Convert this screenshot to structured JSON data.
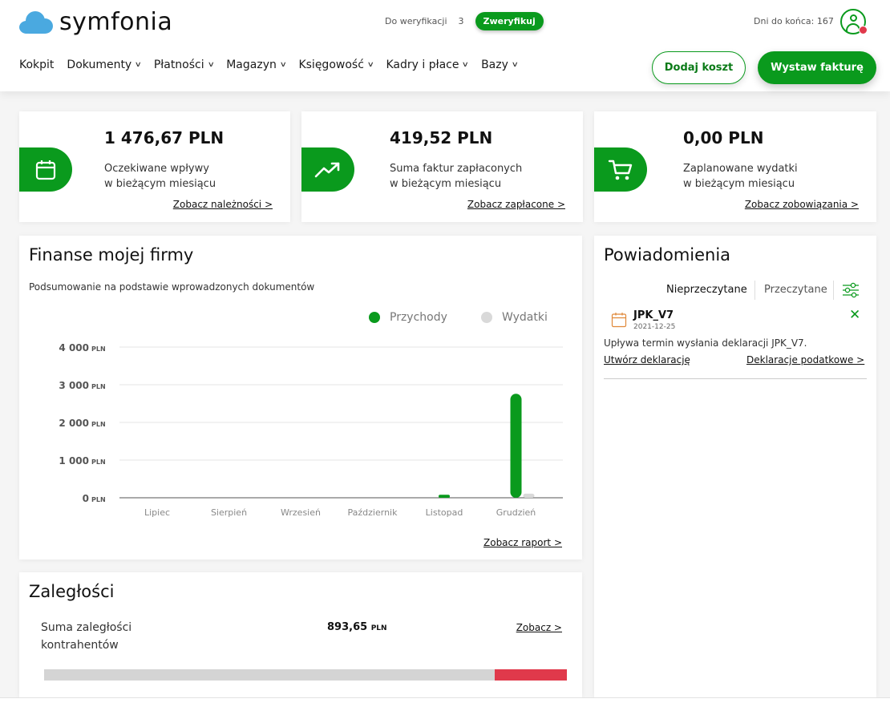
{
  "brand": {
    "name": "symfonia",
    "cloud_color": "#4aa9e0"
  },
  "header": {
    "verification_label": "Do weryfikacji",
    "verification_count": "3",
    "verify_button": "Zweryfikuj",
    "days_left": "Dni do końca: 167",
    "avatar_icon": "user-icon",
    "nav": [
      "Kokpit",
      "Dokumenty",
      "Płatności",
      "Magazyn",
      "Księgowość",
      "Kadry i płace",
      "Bazy"
    ],
    "add_cost_button": "Dodaj koszt",
    "issue_invoice_button": "Wystaw fakturę"
  },
  "colors": {
    "accent": "#0a9a1d",
    "alert": "#e0394b",
    "expense": "#d9d9d9"
  },
  "stats": [
    {
      "amount": "1 476,67 PLN",
      "line1": "Oczekiwane wpływy",
      "line2": "w bieżącym miesiącu",
      "link": "Zobacz należności >",
      "icon": "calendar-icon"
    },
    {
      "amount": "419,52 PLN",
      "line1": "Suma faktur zapłaconych",
      "line2": "w bieżącym miesiącu",
      "link": "Zobacz zapłacone >",
      "icon": "trend-up-icon"
    },
    {
      "amount": "0,00 PLN",
      "line1": "Zaplanowane wydatki",
      "line2": "w bieżącym miesiącu",
      "link": "Zobacz zobowiązania >",
      "icon": "cart-icon"
    }
  ],
  "finance": {
    "title": "Finanse mojej firmy",
    "subtitle": "Podsumowanie na podstawie wprowadzonych dokumentów",
    "report_link": "Zobacz raport >"
  },
  "chart_data": {
    "type": "bar",
    "categories": [
      "Lipiec",
      "Sierpień",
      "Wrzesień",
      "Październik",
      "Listopad",
      "Grudzień"
    ],
    "series": [
      {
        "name": "Przychody",
        "values": [
          0,
          0,
          0,
          0,
          80,
          2760
        ]
      },
      {
        "name": "Wydatki",
        "values": [
          0,
          0,
          0,
          0,
          0,
          110
        ]
      }
    ],
    "yticks": [
      "4 000",
      "3 000",
      "2 000",
      "1 000",
      "0"
    ],
    "yunit": "PLN",
    "ylim": [
      0,
      4000
    ],
    "grid": true,
    "legend": "top-right"
  },
  "arrears": {
    "title": "Zaległości",
    "label": "Suma zaległości kontrahentów",
    "amount": "893,65",
    "unit": "PLN",
    "link": "Zobacz >",
    "overdue_fraction": 0.138
  },
  "notifications": {
    "title": "Powiadomienia",
    "tab_unread": "Nieprzeczytane",
    "tab_read": "Przeczytane",
    "filter_icon": "sliders-icon",
    "items": [
      {
        "title": "JPK_V7",
        "date": "2021-12-25",
        "text": "Upływa termin wysłania deklaracji JPK_V7.",
        "action": "Utwórz deklarację",
        "link": "Deklaracje podatkowe >",
        "icon": "calendar-icon"
      }
    ]
  }
}
